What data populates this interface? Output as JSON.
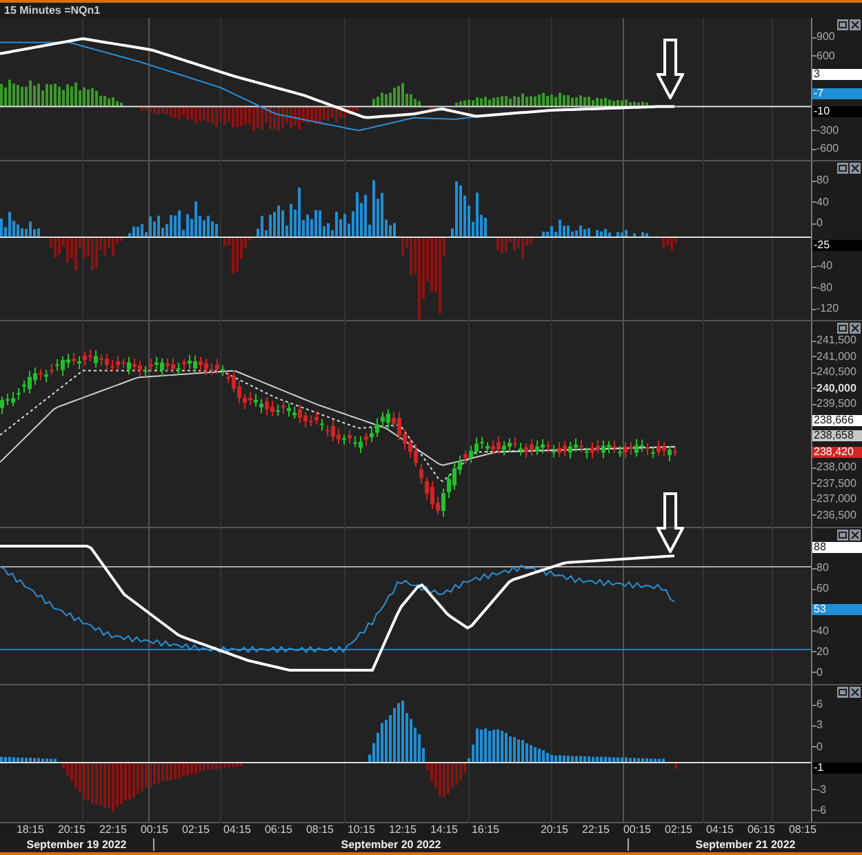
{
  "title": "15 Minutes =NQn1",
  "panels": [
    {
      "kind": "macd",
      "arrow": true,
      "scale": [
        {
          "kind": "tick",
          "label": "900",
          "bold": false
        },
        {
          "kind": "tick",
          "label": "600",
          "bold": false
        },
        {
          "kind": "badge",
          "label": "3",
          "color": "#ffffff"
        },
        {
          "kind": "badge",
          "label": "-7",
          "color": "#1e8fd6"
        },
        {
          "kind": "badge",
          "label": "-10",
          "color": "#000000"
        },
        {
          "kind": "tick",
          "label": "-300",
          "bold": false
        },
        {
          "kind": "tick",
          "label": "-600",
          "bold": false
        }
      ]
    },
    {
      "kind": "momentum",
      "scale": [
        {
          "kind": "tick",
          "label": "80",
          "bold": false
        },
        {
          "kind": "tick",
          "label": "40",
          "bold": false
        },
        {
          "kind": "tick",
          "label": "0",
          "bold": false
        },
        {
          "kind": "badge",
          "label": "-25",
          "color": "#000000"
        },
        {
          "kind": "tick",
          "label": "-40",
          "bold": false
        },
        {
          "kind": "tick",
          "label": "-80",
          "bold": false
        },
        {
          "kind": "tick",
          "label": "-120",
          "bold": false
        }
      ]
    },
    {
      "kind": "candles",
      "scale": [
        {
          "kind": "tick",
          "label": "241,500",
          "bold": false
        },
        {
          "kind": "tick",
          "label": "241,000",
          "bold": false
        },
        {
          "kind": "tick",
          "label": "240,500",
          "bold": false
        },
        {
          "kind": "tick",
          "label": "240,000",
          "bold": true
        },
        {
          "kind": "tick",
          "label": "239,500",
          "bold": false
        },
        {
          "kind": "badge",
          "label": "238,666",
          "color": "#ffffff"
        },
        {
          "kind": "badge",
          "label": "238,658",
          "color": "#c8c8c8"
        },
        {
          "kind": "badge",
          "label": "238,420",
          "color": "#d42424"
        },
        {
          "kind": "tick",
          "label": "238,000",
          "bold": false
        },
        {
          "kind": "tick",
          "label": "237,500",
          "bold": false
        },
        {
          "kind": "tick",
          "label": "237,000",
          "bold": false
        },
        {
          "kind": "tick",
          "label": "236,500",
          "bold": false
        }
      ]
    },
    {
      "kind": "stochastic",
      "arrow": true,
      "scale": [
        {
          "kind": "badge",
          "label": "88",
          "color": "#ffffff"
        },
        {
          "kind": "tick",
          "label": "80",
          "bold": false
        },
        {
          "kind": "tick",
          "label": "60",
          "bold": false
        },
        {
          "kind": "badge",
          "label": "53",
          "color": "#1e8fd6"
        },
        {
          "kind": "tick",
          "label": "40",
          "bold": false
        },
        {
          "kind": "tick",
          "label": "20",
          "bold": false
        },
        {
          "kind": "tick",
          "label": "0",
          "bold": false
        }
      ]
    },
    {
      "kind": "oscillator",
      "scale": [
        {
          "kind": "tick",
          "label": "6",
          "bold": false
        },
        {
          "kind": "tick",
          "label": "3",
          "bold": false
        },
        {
          "kind": "tick",
          "label": "0",
          "bold": false
        },
        {
          "kind": "badge",
          "label": "-1",
          "color": "#000000"
        },
        {
          "kind": "tick",
          "label": "-3",
          "bold": false
        },
        {
          "kind": "tick",
          "label": "-6",
          "bold": false
        }
      ]
    }
  ],
  "time_axis": {
    "time_groups": [
      [
        "18:15",
        "20:15",
        "22:15",
        "00:15",
        "02:15",
        "04:15",
        "06:15",
        "08:15",
        "10:15",
        "12:15",
        "14:15",
        "16:15"
      ],
      [
        "20:15",
        "22:15",
        "00:15",
        "02:15",
        "04:15",
        "06:15",
        "08:15"
      ]
    ],
    "dates": [
      "September 19 2022",
      "September 20 2022",
      "September 21 2022"
    ]
  }
}
